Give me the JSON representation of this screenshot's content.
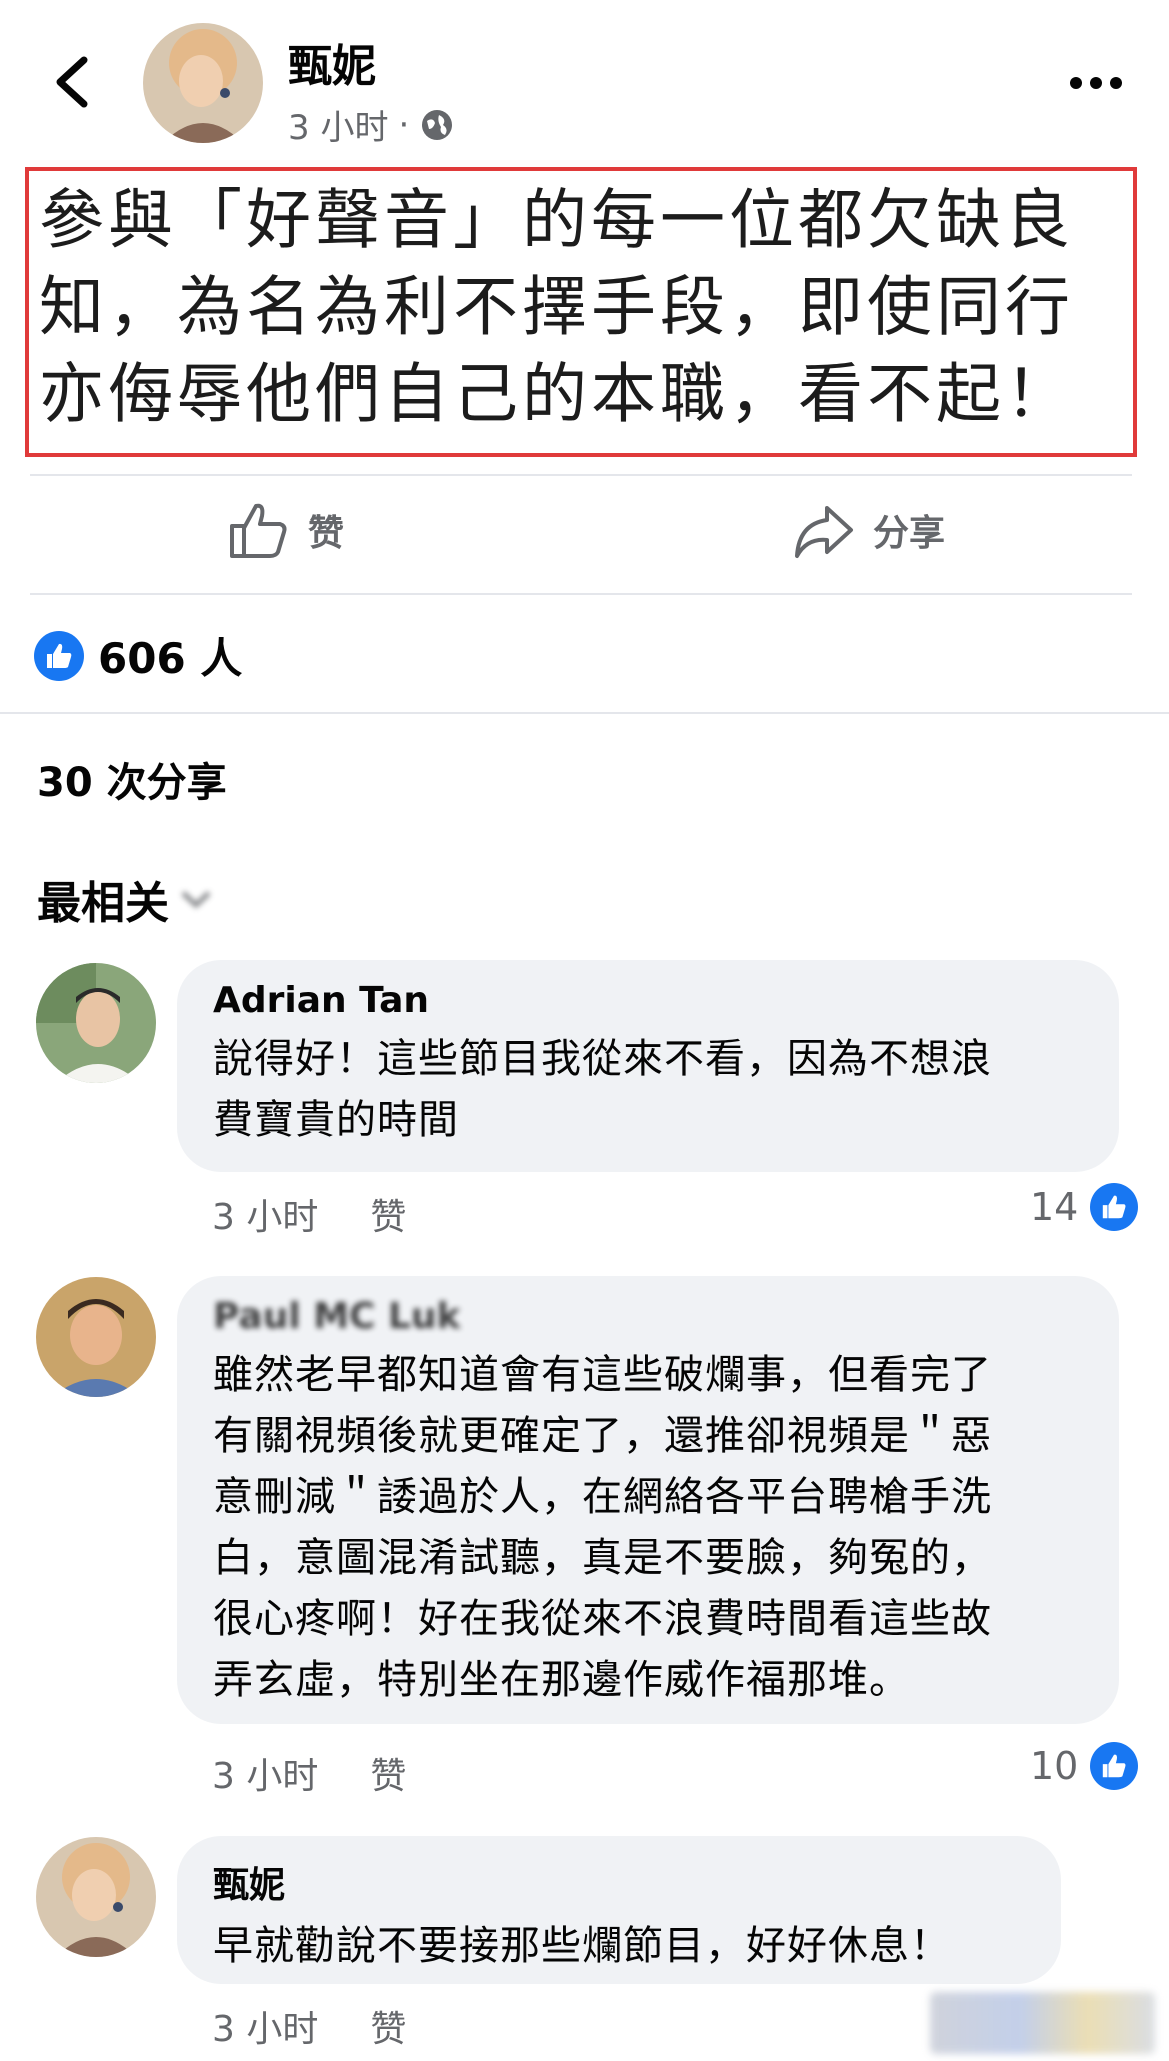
{
  "header": {
    "author": "甄妮",
    "time": "3 小时",
    "separator": "·",
    "privacy_icon": "globe-icon",
    "back_icon": "chevron-left-icon",
    "more_icon": "more-dots-icon"
  },
  "post": {
    "lines": [
      "參與「好聲音」的每一位都欠缺良",
      "知，為名為利不擇手段，即使同行",
      "亦侮辱他們自己的本職，看不起！"
    ],
    "highlight_color": "#e03a3a"
  },
  "actions": {
    "like_label": "赞",
    "share_label": "分享"
  },
  "reactions": {
    "count": "606 人"
  },
  "shares": {
    "text": "30 次分享"
  },
  "sort": {
    "label": "最相关"
  },
  "comments": [
    {
      "name": "Adrian Tan",
      "lines": [
        "說得好！這些節目我從來不看，因為不想浪",
        "費寶貴的時間"
      ],
      "time": "3 小时",
      "like_label": "赞",
      "likes": "14"
    },
    {
      "name": "Paul MC Luk",
      "lines": [
        "雖然老早都知道會有這些破爛事，但看完了",
        "有關視頻後就更確定了，還推卻視頻是＂惡",
        "意刪減＂諉過於人，在網絡各平台聘槍手洗",
        "白，意圖混淆試聽，真是不要臉，夠冤的，",
        "很心疼啊！好在我從來不浪費時間看這些故",
        "弄玄虛，特別坐在那邊作威作福那堆。"
      ],
      "time": "3 小时",
      "like_label": "赞",
      "likes": "10"
    },
    {
      "name": "甄妮",
      "lines": [
        "早就勸說不要接那些爛節目，好好休息！"
      ],
      "time": "3 小时",
      "like_label": "赞",
      "likes": ""
    }
  ],
  "colors": {
    "facebook_blue": "#1877f2",
    "meta_gray": "#65676b",
    "bubble_bg": "#f0f2f5"
  }
}
